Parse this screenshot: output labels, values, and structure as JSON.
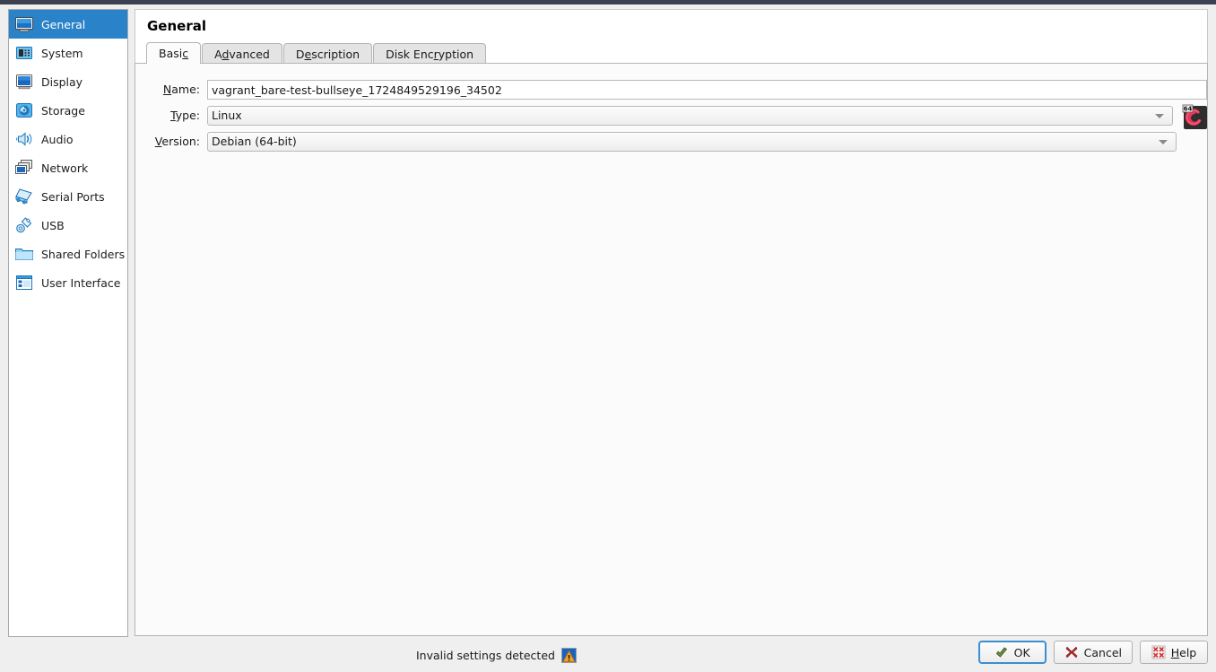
{
  "window": {
    "title": "General"
  },
  "sidebar": {
    "items": [
      {
        "label": "General",
        "icon": "monitor-icon",
        "selected": true
      },
      {
        "label": "System",
        "icon": "motherboard-icon",
        "selected": false
      },
      {
        "label": "Display",
        "icon": "display-icon",
        "selected": false
      },
      {
        "label": "Storage",
        "icon": "harddisk-icon",
        "selected": false
      },
      {
        "label": "Audio",
        "icon": "speaker-icon",
        "selected": false
      },
      {
        "label": "Network",
        "icon": "network-icon",
        "selected": false
      },
      {
        "label": "Serial Ports",
        "icon": "serial-port-icon",
        "selected": false
      },
      {
        "label": "USB",
        "icon": "usb-icon",
        "selected": false
      },
      {
        "label": "Shared Folders",
        "icon": "folder-icon",
        "selected": false
      },
      {
        "label": "User Interface",
        "icon": "user-interface-icon",
        "selected": false
      }
    ]
  },
  "main": {
    "heading": "General",
    "tabs": [
      {
        "label_before": "Basi",
        "mnemonic": "c",
        "label_after": "",
        "active": true
      },
      {
        "label_before": "A",
        "mnemonic": "d",
        "label_after": "vanced",
        "active": false
      },
      {
        "label_before": "D",
        "mnemonic": "e",
        "label_after": "scription",
        "active": false
      },
      {
        "label_before": "Disk Enc",
        "mnemonic": "r",
        "label_after": "yption",
        "active": false
      }
    ],
    "fields": {
      "name": {
        "label_before": "",
        "mnemonic": "N",
        "label_after": "ame:",
        "value": "vagrant_bare-test-bullseye_1724849529196_34502"
      },
      "type": {
        "label_before": "",
        "mnemonic": "T",
        "label_after": "ype:",
        "value": "Linux"
      },
      "version": {
        "label_before": "",
        "mnemonic": "V",
        "label_after": "ersion:",
        "value": "Debian (64-bit)"
      }
    },
    "os_icon": {
      "name": "debian-os-icon",
      "badge": "64"
    }
  },
  "footer": {
    "status_text": "Invalid settings detected",
    "status_icon": "warning-icon",
    "buttons": [
      {
        "label_before": "OK",
        "mnemonic": "",
        "label_after": "",
        "icon": "check-arrow-icon",
        "focused": true
      },
      {
        "label_before": "Cancel",
        "mnemonic": "",
        "label_after": "",
        "icon": "cross-icon",
        "focused": false
      },
      {
        "label_before": "",
        "mnemonic": "H",
        "label_after": "elp",
        "icon": "help-arrows-icon",
        "focused": false
      }
    ]
  },
  "colors": {
    "accent": "#2a82c8",
    "top_strip": "#3c4151",
    "panel_bg": "#fbfbfb",
    "warning": "#f0a22e",
    "cancel": "#c0392b"
  }
}
